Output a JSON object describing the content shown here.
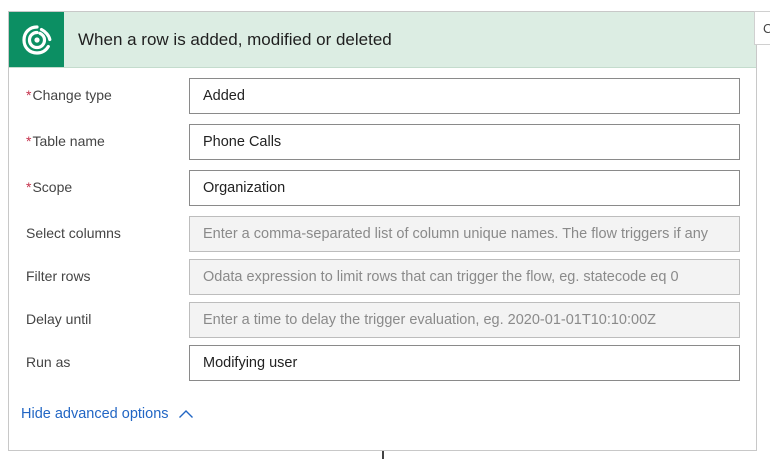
{
  "trigger": {
    "title": "When a row is added, modified or deleted",
    "icon": "dataverse-logo-icon",
    "header_color": "#dcede3",
    "icon_bg_color": "#0c8f63"
  },
  "fields": [
    {
      "label": "Change type",
      "required": true,
      "value": "Added",
      "placeholder": ""
    },
    {
      "label": "Table name",
      "required": true,
      "value": "Phone Calls",
      "placeholder": ""
    },
    {
      "label": "Scope",
      "required": true,
      "value": "Organization",
      "placeholder": ""
    },
    {
      "label": "Select columns",
      "required": false,
      "value": "",
      "placeholder": "Enter a comma-separated list of column unique names. The flow triggers if any"
    },
    {
      "label": "Filter rows",
      "required": false,
      "value": "",
      "placeholder": "Odata expression to limit rows that can trigger the flow, eg. statecode eq 0"
    },
    {
      "label": "Delay until",
      "required": false,
      "value": "",
      "placeholder": "Enter a time to delay the trigger evaluation, eg. 2020-01-01T10:10:00Z"
    },
    {
      "label": "Run as",
      "required": false,
      "value": "Modifying user",
      "placeholder": ""
    }
  ],
  "required_marker": "*",
  "advanced": {
    "label": "Hide advanced options",
    "icon": "chevron-up-icon"
  },
  "side_tab": {
    "label": "C"
  }
}
